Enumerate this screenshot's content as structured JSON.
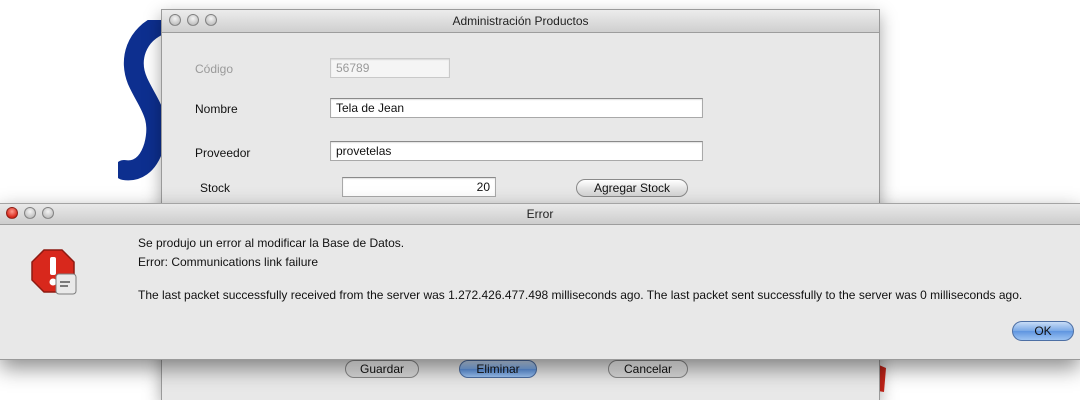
{
  "main_window": {
    "title": "Administración Productos",
    "fields": {
      "codigo": {
        "label": "Código",
        "value": "56789"
      },
      "nombre": {
        "label": "Nombre",
        "value": "Tela de Jean"
      },
      "proveedor": {
        "label": "Proveedor",
        "value": "provetelas"
      },
      "stock": {
        "label": "Stock",
        "value": "20"
      }
    },
    "buttons": {
      "agregar_stock": "Agregar Stock",
      "guardar": "Guardar",
      "eliminar": "Eliminar",
      "cancelar": "Cancelar"
    }
  },
  "error_dialog": {
    "title": "Error",
    "line1": "Se produjo un error al modificar la Base de Datos.",
    "line2": "Error: Communications link failure",
    "line3": "The last packet successfully received from the server was 1.272.426.477.498 milliseconds ago.  The last packet sent successfully to the server was 0 milliseconds ago.",
    "ok_label": "OK",
    "icon": "stop-sign-icon"
  },
  "colors": {
    "default_button": "#6f9fe2",
    "stop_icon": "#d8281c",
    "background_logo": "#0d2f8f"
  }
}
